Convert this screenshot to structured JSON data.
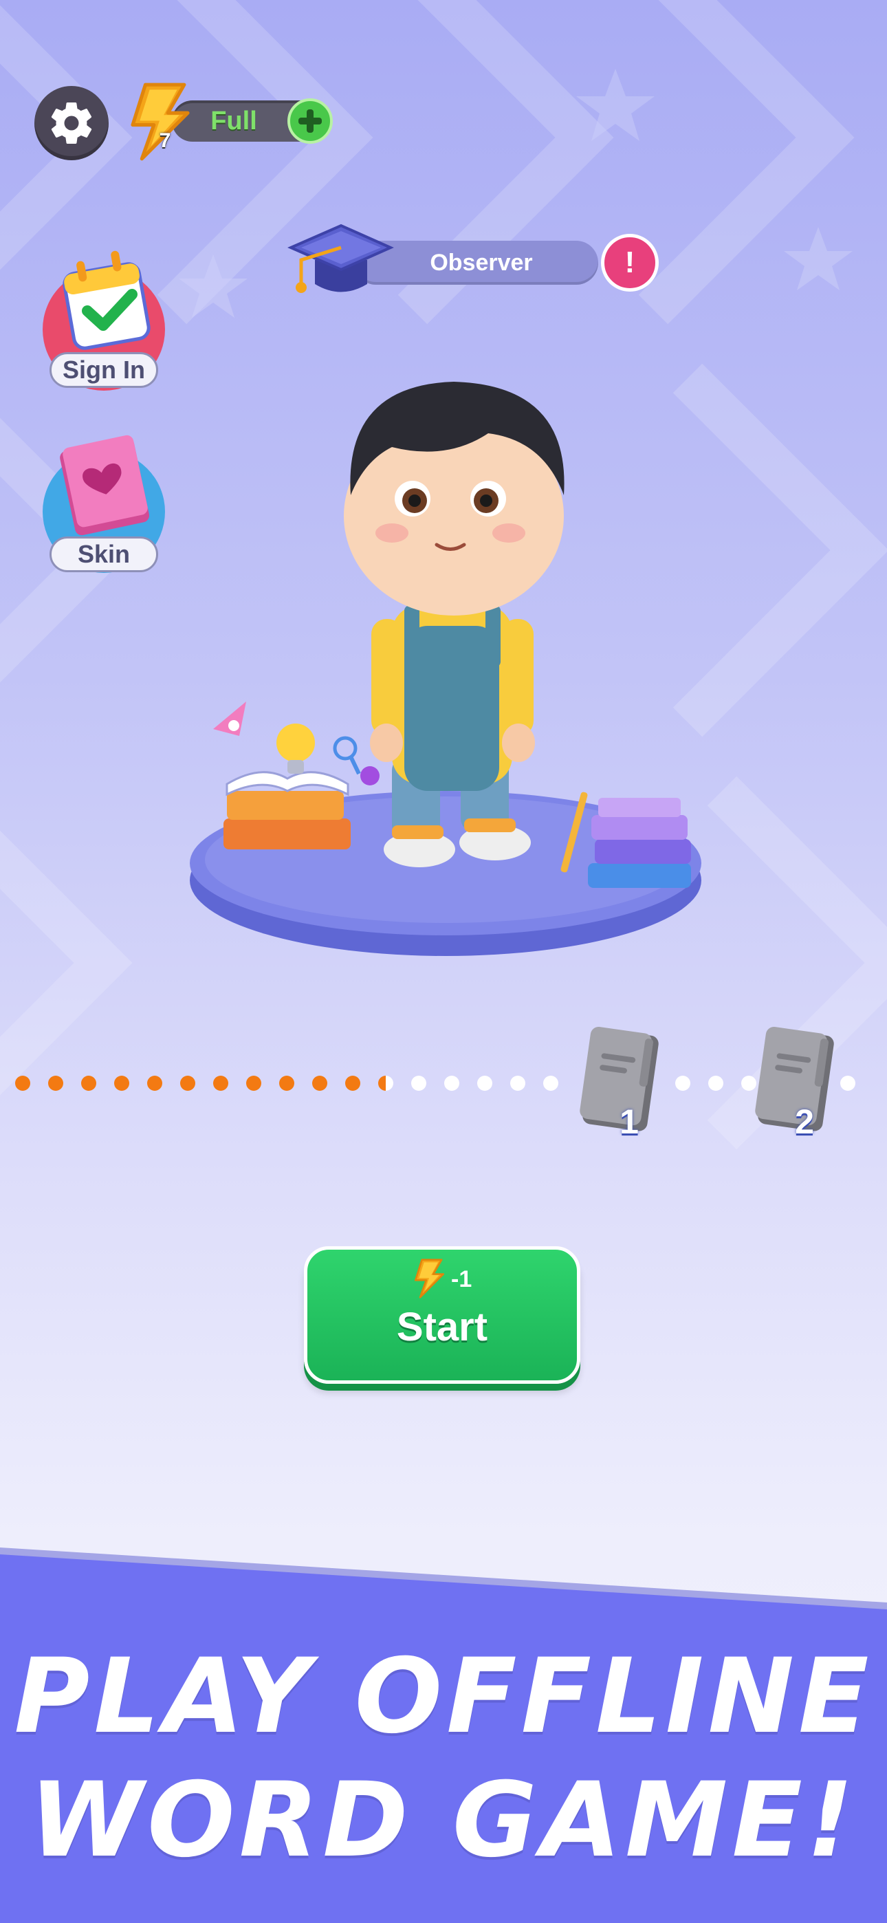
{
  "header": {
    "energy_status": "Full",
    "energy_count": "7"
  },
  "rank": {
    "title": "Observer",
    "info_symbol": "!"
  },
  "side_buttons": {
    "sign_in_label": "Sign In",
    "skin_label": "Skin"
  },
  "progress": {
    "filled_dots": 11.5,
    "milestones": [
      "1",
      "2"
    ]
  },
  "start": {
    "cost": "-1",
    "label": "Start"
  },
  "banner": {
    "line1": "PLAY OFFLINE",
    "line2": "WORD GAME!"
  },
  "colors": {
    "accent_green": "#1fc45e",
    "banner_purple": "#6f71f2",
    "progress_orange": "#f37a12",
    "info_pink": "#e8407c"
  }
}
